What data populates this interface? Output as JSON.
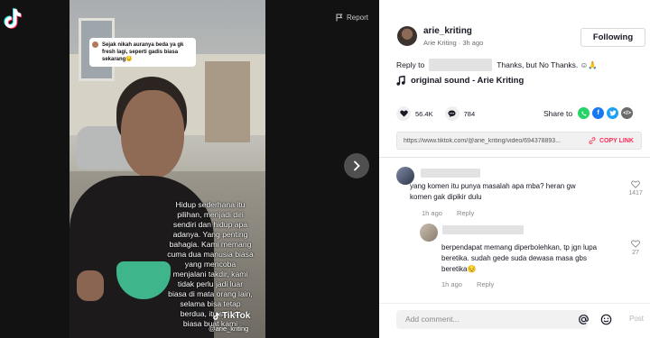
{
  "video": {
    "report_label": "Report",
    "comment_bubble": "Sejak nikah auranya beda ya gk fresh lagi, seperti gadis biasa sekarang😔",
    "overlay_lines": [
      "Hidup sederhana itu",
      "pilihan, menjadi diri",
      "sendiri dan hidup apa",
      "adanya. Yang penting",
      "bahagia. Kami memang",
      "cuma dua manusia biasa",
      "yang mencoba",
      "menjalani takdir, kami",
      "tidak perlu jadi luar",
      "biasa di mata orang lain,",
      "selama bisa tetap",
      "berdua, itu sudah",
      "biasa buat kami"
    ],
    "watermark_brand": "TikTok",
    "watermark_handle": "@arie_kriting"
  },
  "author": {
    "username": "arie_kriting",
    "display_name": "Arie Kriting",
    "time": "3h ago",
    "follow_label": "Following"
  },
  "caption": {
    "prefix": "Reply to",
    "text": "Thanks, but No Thanks. ☺🙏"
  },
  "sound": "original sound - Arie Kriting",
  "stats": {
    "likes": "56.4K",
    "comments": "784",
    "share_label": "Share to"
  },
  "share_colors": {
    "whatsapp": "#25d366",
    "facebook": "#1877f2",
    "twitter": "#1da1f2",
    "embed": "#6b6b6b"
  },
  "link": {
    "url": "https://www.tiktok.com/@arie_kriting/video/694378893...",
    "copy_label": "COPY LINK"
  },
  "comments": [
    {
      "text_lines": [
        "yang komen itu punya masalah apa mba? heran gw",
        "komen gak dipikir dulu"
      ],
      "time": "1h ago",
      "reply_label": "Reply",
      "likes": "1417"
    },
    {
      "text_lines": [
        "berpendapat memang diperbolehkan, tp jgn lupa",
        "beretika. sudah gede suda dewasa masa gbs",
        "beretika😔"
      ],
      "time": "1h ago",
      "reply_label": "Reply",
      "likes": "27"
    }
  ],
  "comment_input": {
    "placeholder": "Add comment...",
    "post_label": "Post"
  },
  "colors": {
    "accent": "#fe2c55",
    "text": "#161823"
  }
}
